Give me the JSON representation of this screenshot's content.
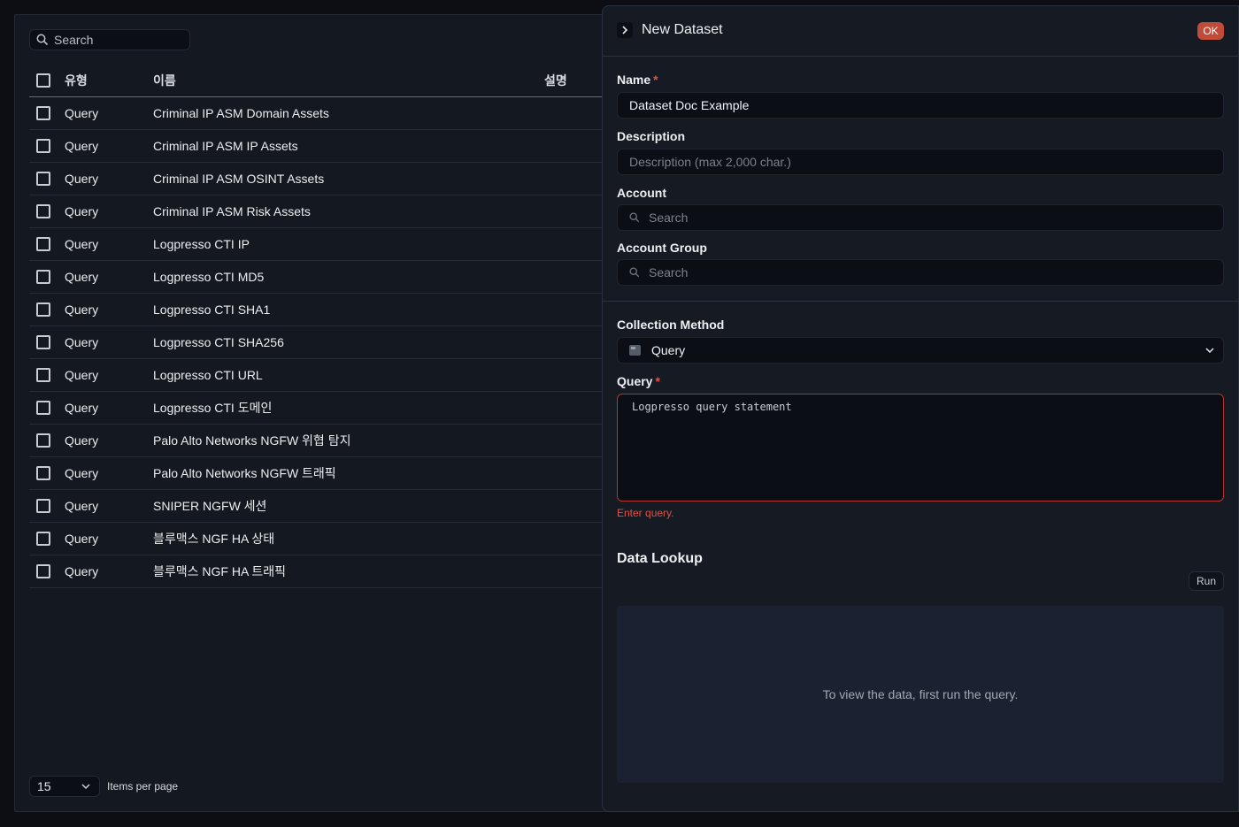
{
  "list": {
    "search_placeholder": "Search",
    "columns": {
      "type": "유형",
      "name": "이름",
      "description": "설명"
    },
    "rows": [
      {
        "type": "Query",
        "name": "Criminal IP ASM Domain Assets"
      },
      {
        "type": "Query",
        "name": "Criminal IP ASM IP Assets"
      },
      {
        "type": "Query",
        "name": "Criminal IP ASM OSINT Assets"
      },
      {
        "type": "Query",
        "name": "Criminal IP ASM Risk Assets"
      },
      {
        "type": "Query",
        "name": "Logpresso CTI IP"
      },
      {
        "type": "Query",
        "name": "Logpresso CTI MD5"
      },
      {
        "type": "Query",
        "name": "Logpresso CTI SHA1"
      },
      {
        "type": "Query",
        "name": "Logpresso CTI SHA256"
      },
      {
        "type": "Query",
        "name": "Logpresso CTI URL"
      },
      {
        "type": "Query",
        "name": "Logpresso CTI 도메인"
      },
      {
        "type": "Query",
        "name": "Palo Alto Networks NGFW 위협 탐지"
      },
      {
        "type": "Query",
        "name": "Palo Alto Networks NGFW 트래픽"
      },
      {
        "type": "Query",
        "name": "SNIPER NGFW 세션"
      },
      {
        "type": "Query",
        "name": "블루맥스 NGF HA 상태"
      },
      {
        "type": "Query",
        "name": "블루맥스 NGF HA 트래픽"
      }
    ],
    "pager": {
      "page_size": "15",
      "label": "Items per page"
    }
  },
  "drawer": {
    "title": "New Dataset",
    "ok_label": "OK",
    "name": {
      "label": "Name",
      "required_mark": "*",
      "value": "Dataset Doc Example"
    },
    "description": {
      "label": "Description",
      "placeholder": "Description (max 2,000 char.)"
    },
    "account": {
      "label": "Account",
      "placeholder": "Search"
    },
    "account_group": {
      "label": "Account Group",
      "placeholder": "Search"
    },
    "collection_method": {
      "label": "Collection Method",
      "value": "Query"
    },
    "query": {
      "label": "Query",
      "required_mark": "*",
      "placeholder": "Logpresso query statement",
      "error": "Enter query."
    },
    "data_lookup": {
      "title": "Data Lookup",
      "run_label": "Run",
      "empty_message": "To view the data, first run the query."
    }
  },
  "colors": {
    "background": "#0c0e13",
    "panel": "#141820",
    "accent": "#c24a39",
    "error": "#e0524a"
  }
}
